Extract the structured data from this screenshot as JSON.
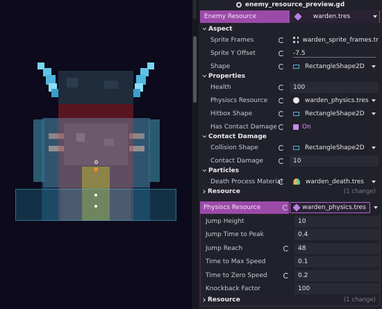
{
  "inspector": {
    "file_title": "enemy_resource_preview.gd",
    "enemy_resource": {
      "label": "Enemy Resource",
      "value": "warden.tres"
    },
    "sections": {
      "aspect": "Aspect",
      "properties": "Properties",
      "contact_damage": "Contact Damage",
      "particles": "Particles",
      "resource": "Resource",
      "resource_change": "(1 change)"
    },
    "props": {
      "sprite_frames": {
        "label": "Sprite Frames",
        "value": "warden_sprite_frames.tr"
      },
      "sprite_y_offset": {
        "label": "Sprite Y Offset",
        "value": "-7.5"
      },
      "shape": {
        "label": "Shape",
        "value": "RectangleShape2D"
      },
      "health": {
        "label": "Health",
        "value": "100"
      },
      "physics_resource": {
        "label": "Physiscs Resource",
        "value": "warden_physics.tres"
      },
      "hitbox_shape": {
        "label": "Hitbox Shape",
        "value": "RectangleShape2D"
      },
      "has_contact_damage": {
        "label": "Has Contact Damage",
        "value": "On"
      },
      "collision_shape": {
        "label": "Collision Shape",
        "value": "RectangleShape2D"
      },
      "contact_damage": {
        "label": "Contact Damage",
        "value": "10"
      },
      "death_process_material": {
        "label": "Death Process Material",
        "value": "warden_death.tres"
      }
    },
    "physics_panel": {
      "label": "Physiscs Resource",
      "value": "warden_physics.tres",
      "props": [
        {
          "label": "Jump Height",
          "value": "10"
        },
        {
          "label": "Jump Time to Peak",
          "value": "0.4"
        },
        {
          "label": "Jump Reach",
          "value": "48"
        },
        {
          "label": "Time to Max Speed",
          "value": "0.1"
        },
        {
          "label": "Time to Zero Speed",
          "value": "0.2"
        },
        {
          "label": "Knockback Factor",
          "value": "100"
        }
      ],
      "resource": "Resource",
      "resource_change": "(1 change)"
    },
    "icons": {
      "gear": "gear-icon",
      "resource": "cube-resource-icon",
      "revert": "revert-icon",
      "shape": "rectangle-shape-icon",
      "frames": "sprite-frames-icon",
      "physics": "physics-icon",
      "death": "particle-material-icon",
      "checkbox": "checkbox-icon"
    },
    "colors": {
      "accent_purple": "#9b4aa8",
      "checkbox": "#c78be6",
      "shape_icon": "#4fb4e8",
      "background": "#21212b",
      "viewport": "#0c0a1c"
    }
  }
}
